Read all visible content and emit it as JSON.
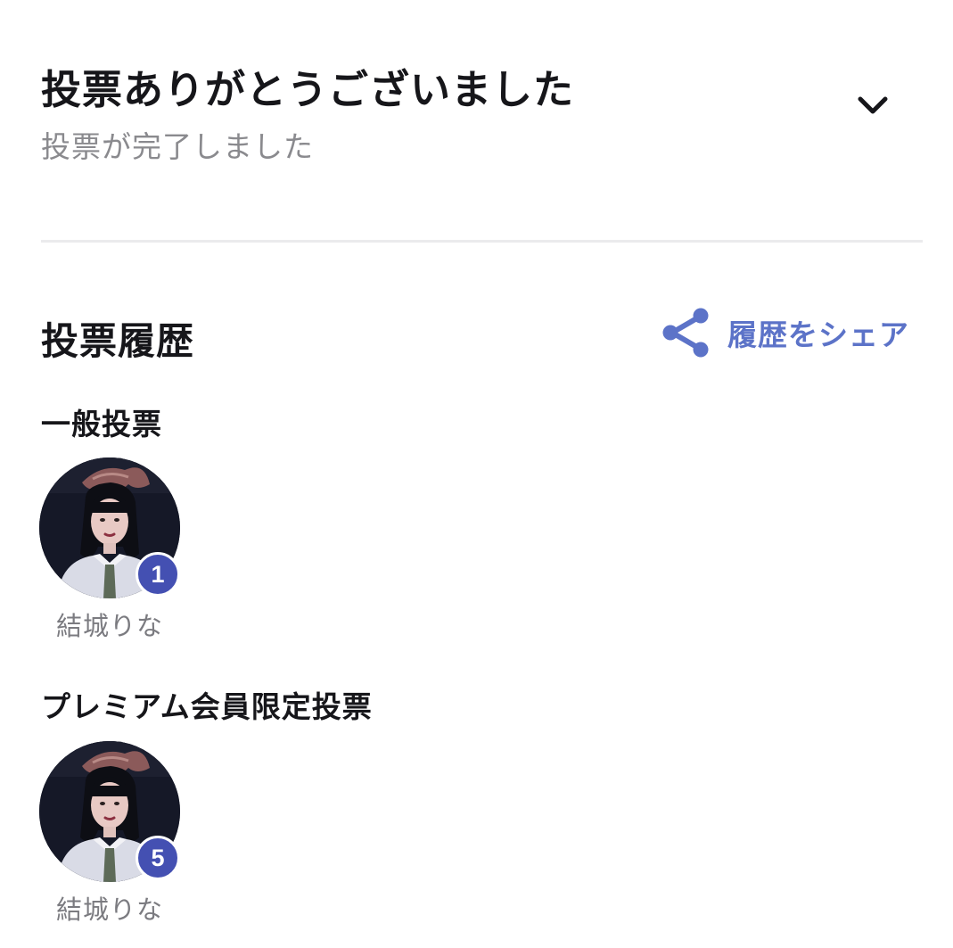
{
  "header": {
    "title": "投票ありがとうございました",
    "subtitle": "投票が完了しました",
    "toggle_icon": "chevron-down-icon"
  },
  "history": {
    "title": "投票履歴",
    "share_label": "履歴をシェア",
    "share_icon": "share-icon",
    "accent_color": "#5c73c8"
  },
  "sections": [
    {
      "title": "一般投票",
      "candidate": {
        "name": "結城りな",
        "vote_count": "1"
      }
    },
    {
      "title": "プレミアム会員限定投票",
      "candidate": {
        "name": "結城りな",
        "vote_count": "5"
      }
    }
  ],
  "colors": {
    "badge": "#4450b2",
    "title_text": "#16161a",
    "secondary_text": "#8a8a8e"
  }
}
